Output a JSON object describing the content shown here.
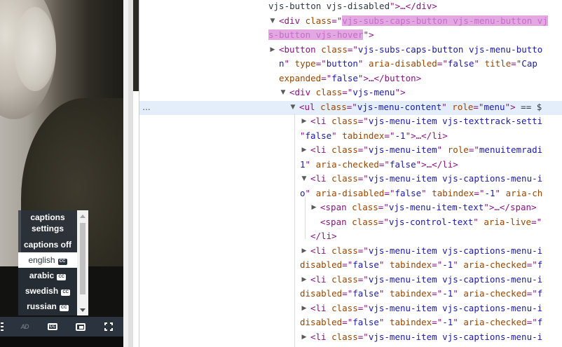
{
  "player": {
    "captions_menu": {
      "items": [
        {
          "label": "captions settings",
          "selected": false,
          "cc": false
        },
        {
          "label": "captions off",
          "selected": false,
          "cc": false
        },
        {
          "label": "english",
          "selected": true,
          "cc": true
        },
        {
          "label": "arabic",
          "selected": false,
          "cc": true
        },
        {
          "label": "swedish",
          "selected": false,
          "cc": true
        },
        {
          "label": "russian",
          "selected": false,
          "cc": true
        }
      ],
      "cc_badge": "CC"
    },
    "controls": {
      "audio_description_icon": "AD",
      "captions_icon": "CC"
    },
    "colors": {
      "control_bar": "#2b333f",
      "menu_selected_bg": "#ffffff"
    }
  },
  "devtools": {
    "ellipsis": "...",
    "lines": [
      [
        [
          "plain",
          "vjs-button vjs-disabled"
        ],
        [
          "tag",
          "\">…</div>"
        ]
      ],
      [
        [
          "tag",
          "<div "
        ],
        [
          "attr",
          "class"
        ],
        [
          "tag",
          "=\""
        ],
        [
          "sel",
          "vjs-subs-caps-button vjs-menu-button vj"
        ]
      ],
      [
        [
          "sel",
          "s-button vjs-hover"
        ],
        [
          "tag",
          "\">"
        ]
      ],
      [
        [
          "tag",
          "<button "
        ],
        [
          "attr",
          "class"
        ],
        [
          "tag",
          "=\""
        ],
        [
          "val",
          "vjs-subs-caps-button vjs-menu-butto"
        ]
      ],
      [
        [
          "val",
          "n"
        ],
        [
          "tag",
          "\" "
        ],
        [
          "attr",
          "type"
        ],
        [
          "tag",
          "=\""
        ],
        [
          "val",
          "button"
        ],
        [
          "tag",
          "\" "
        ],
        [
          "attr",
          "aria-disabled"
        ],
        [
          "tag",
          "=\""
        ],
        [
          "val",
          "false"
        ],
        [
          "tag",
          "\" "
        ],
        [
          "attr",
          "title"
        ],
        [
          "tag",
          "=\""
        ],
        [
          "val",
          "Cap"
        ]
      ],
      [
        [
          "attr",
          "expanded"
        ],
        [
          "tag",
          "=\""
        ],
        [
          "val",
          "false"
        ],
        [
          "tag",
          "\">…</button>"
        ]
      ],
      [
        [
          "tag",
          "<div "
        ],
        [
          "attr",
          "class"
        ],
        [
          "tag",
          "=\""
        ],
        [
          "val",
          "vjs-menu"
        ],
        [
          "tag",
          "\">"
        ]
      ],
      [
        [
          "tag",
          "<ul "
        ],
        [
          "attr",
          "class"
        ],
        [
          "tag",
          "=\""
        ],
        [
          "val",
          "vjs-menu-content"
        ],
        [
          "tag",
          "\" "
        ],
        [
          "attr",
          "role"
        ],
        [
          "tag",
          "=\""
        ],
        [
          "val",
          "menu"
        ],
        [
          "tag",
          "\">"
        ],
        [
          "plain",
          " == $"
        ]
      ],
      [
        [
          "tag",
          "<li "
        ],
        [
          "attr",
          "class"
        ],
        [
          "tag",
          "=\""
        ],
        [
          "val",
          "vjs-menu-item vjs-texttrack-setti"
        ]
      ],
      [
        [
          "tag",
          "\""
        ],
        [
          "val",
          "false"
        ],
        [
          "tag",
          "\" "
        ],
        [
          "attr",
          "tabindex"
        ],
        [
          "tag",
          "=\""
        ],
        [
          "val",
          "-1"
        ],
        [
          "tag",
          "\">…</li>"
        ]
      ],
      [
        [
          "tag",
          "<li "
        ],
        [
          "attr",
          "class"
        ],
        [
          "tag",
          "=\""
        ],
        [
          "val",
          "vjs-menu-item"
        ],
        [
          "tag",
          "\" "
        ],
        [
          "attr",
          "role"
        ],
        [
          "tag",
          "=\""
        ],
        [
          "val",
          "menuitemradi"
        ]
      ],
      [
        [
          "val",
          "1"
        ],
        [
          "tag",
          "\" "
        ],
        [
          "attr",
          "aria-checked"
        ],
        [
          "tag",
          "=\""
        ],
        [
          "val",
          "false"
        ],
        [
          "tag",
          "\">…</li>"
        ]
      ],
      [
        [
          "tag",
          "<li "
        ],
        [
          "attr",
          "class"
        ],
        [
          "tag",
          "=\""
        ],
        [
          "val",
          "vjs-menu-item vjs-captions-menu-i"
        ]
      ],
      [
        [
          "val",
          "o"
        ],
        [
          "tag",
          "\" "
        ],
        [
          "attr",
          "aria-disabled"
        ],
        [
          "tag",
          "=\""
        ],
        [
          "val",
          "false"
        ],
        [
          "tag",
          "\" "
        ],
        [
          "attr",
          "tabindex"
        ],
        [
          "tag",
          "=\""
        ],
        [
          "val",
          "-1"
        ],
        [
          "tag",
          "\" "
        ],
        [
          "attr",
          "aria-ch"
        ]
      ],
      [
        [
          "tag",
          "<span "
        ],
        [
          "attr",
          "class"
        ],
        [
          "tag",
          "=\""
        ],
        [
          "val",
          "vjs-menu-item-text"
        ],
        [
          "tag",
          "\">…</span>"
        ]
      ],
      [
        [
          "tag",
          "<span "
        ],
        [
          "attr",
          "class"
        ],
        [
          "tag",
          "=\""
        ],
        [
          "val",
          "vjs-control-text"
        ],
        [
          "tag",
          "\" "
        ],
        [
          "attr",
          "aria-live"
        ],
        [
          "tag",
          "=\""
        ]
      ],
      [
        [
          "tag",
          "</li>"
        ]
      ],
      [
        [
          "tag",
          "<li "
        ],
        [
          "attr",
          "class"
        ],
        [
          "tag",
          "=\""
        ],
        [
          "val",
          "vjs-menu-item vjs-captions-menu-i"
        ]
      ],
      [
        [
          "attr",
          "disabled"
        ],
        [
          "tag",
          "=\""
        ],
        [
          "val",
          "false"
        ],
        [
          "tag",
          "\" "
        ],
        [
          "attr",
          "tabindex"
        ],
        [
          "tag",
          "=\""
        ],
        [
          "val",
          "-1"
        ],
        [
          "tag",
          "\" "
        ],
        [
          "attr",
          "aria-checked"
        ],
        [
          "tag",
          "=\""
        ],
        [
          "val",
          "f"
        ]
      ],
      [
        [
          "tag",
          "<li "
        ],
        [
          "attr",
          "class"
        ],
        [
          "tag",
          "=\""
        ],
        [
          "val",
          "vjs-menu-item vjs-captions-menu-i"
        ]
      ],
      [
        [
          "attr",
          "disabled"
        ],
        [
          "tag",
          "=\""
        ],
        [
          "val",
          "false"
        ],
        [
          "tag",
          "\" "
        ],
        [
          "attr",
          "tabindex"
        ],
        [
          "tag",
          "=\""
        ],
        [
          "val",
          "-1"
        ],
        [
          "tag",
          "\" "
        ],
        [
          "attr",
          "aria-checked"
        ],
        [
          "tag",
          "=\""
        ],
        [
          "val",
          "f"
        ]
      ],
      [
        [
          "tag",
          "<li "
        ],
        [
          "attr",
          "class"
        ],
        [
          "tag",
          "=\""
        ],
        [
          "val",
          "vjs-menu-item vjs-captions-menu-i"
        ]
      ],
      [
        [
          "attr",
          "disabled"
        ],
        [
          "tag",
          "=\""
        ],
        [
          "val",
          "false"
        ],
        [
          "tag",
          "\" "
        ],
        [
          "attr",
          "tabindex"
        ],
        [
          "tag",
          "=\""
        ],
        [
          "val",
          "-1"
        ],
        [
          "tag",
          "\" "
        ],
        [
          "attr",
          "aria-checked"
        ],
        [
          "tag",
          "=\""
        ],
        [
          "val",
          "f"
        ]
      ],
      [
        [
          "tag",
          "<li "
        ],
        [
          "attr",
          "class"
        ],
        [
          "tag",
          "=\""
        ],
        [
          "val",
          "vjs-menu-item vjs-captions-menu-i"
        ]
      ]
    ]
  }
}
